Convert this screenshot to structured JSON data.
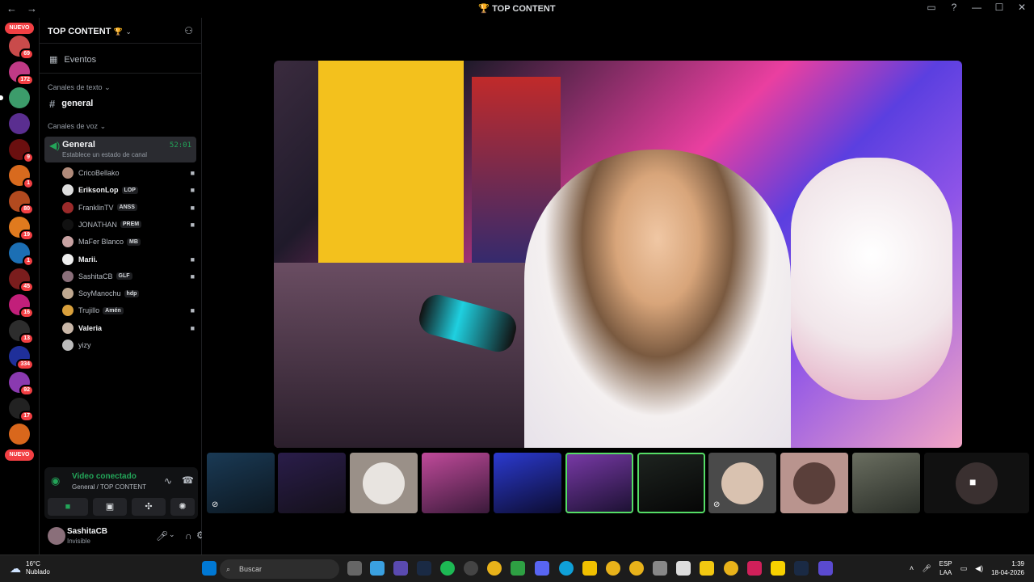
{
  "window": {
    "title": "TOP CONTENT",
    "title_emoji": "🏆"
  },
  "servers": {
    "nuevo_label": "NUEVO",
    "badges": [
      "69",
      "172",
      "9",
      "1",
      "80",
      "19",
      "1",
      "45",
      "16",
      "13",
      "334",
      "92",
      "17"
    ]
  },
  "sidebar": {
    "guild_name": "TOP CONTENT",
    "events_label": "Eventos",
    "text_category": "Canales de texto",
    "text_channel": "general",
    "voice_category": "Canales de voz",
    "voice_channel": {
      "name": "General",
      "status_placeholder": "Establece un estado de canal",
      "timer": "52:01"
    },
    "members": [
      {
        "name": "CricoBellako",
        "tag": "",
        "color": "#b08a7a",
        "active": false,
        "video": true
      },
      {
        "name": "EriksonLop",
        "tag": "LOP",
        "color": "#ddd",
        "active": true,
        "video": true
      },
      {
        "name": "FranklinTV",
        "tag": "ANSS",
        "color": "#9b2a2a",
        "active": false,
        "video": true
      },
      {
        "name": "JONATHAN",
        "tag": "PREM",
        "color": "#111",
        "active": false,
        "video": true
      },
      {
        "name": "MaFer Blanco",
        "tag": "MB",
        "color": "#c8a2a2",
        "active": false,
        "video": false
      },
      {
        "name": "Marii.",
        "tag": "",
        "color": "#eee",
        "active": true,
        "video": true
      },
      {
        "name": "SashitaCB",
        "tag": "GLF",
        "color": "#8a6f7a",
        "active": false,
        "video": true
      },
      {
        "name": "SoyManochu",
        "tag": "hdp",
        "color": "#bfa890",
        "active": false,
        "video": false
      },
      {
        "name": "Trujillo",
        "tag": "Amén",
        "color": "#d9a03c",
        "active": false,
        "video": true
      },
      {
        "name": "Valeria",
        "tag": "",
        "color": "#c9b7a8",
        "active": true,
        "video": true
      },
      {
        "name": "yizy",
        "tag": "",
        "color": "#bbb",
        "active": false,
        "video": false
      }
    ],
    "voice_status": "Video conectado",
    "voice_sub": "General / TOP CONTENT",
    "user_name": "SashitaCB",
    "user_status": "Invisible"
  },
  "taskbar": {
    "temp": "16°C",
    "weather": "Nublado",
    "search_placeholder": "Buscar",
    "lang1": "ESP",
    "lang2": "LAA",
    "time": "1:39",
    "date": "18-04-2026"
  },
  "colors": {
    "connected_green": "#23a559",
    "badge_red": "#f23f43",
    "panel": "#111214"
  }
}
